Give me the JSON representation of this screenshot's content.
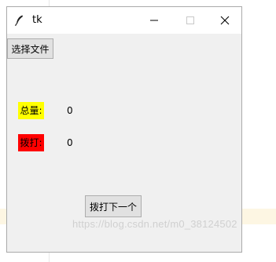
{
  "window": {
    "title": "tk",
    "icon": "feather-icon"
  },
  "buttons": {
    "choose_file": "选择文件",
    "dial_next": "拨打下一个"
  },
  "stats": {
    "total_label": "总量:",
    "total_value": "0",
    "dialed_label": "拨打:",
    "dialed_value": "0"
  },
  "colors": {
    "total_tag": "#ffff00",
    "dialed_tag": "#ff0000",
    "window_bg": "#f0f0f0"
  },
  "watermark": "https://blog.csdn.net/m0_38124502"
}
